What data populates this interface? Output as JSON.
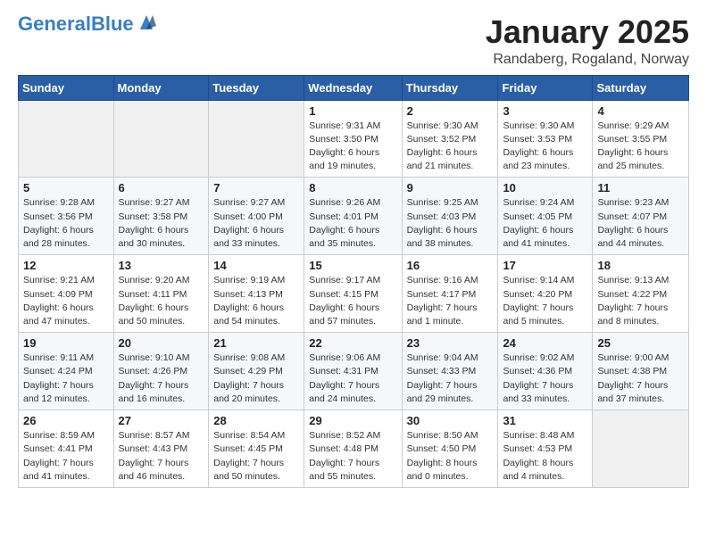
{
  "header": {
    "logo_main": "General",
    "logo_accent": "Blue",
    "main_title": "January 2025",
    "subtitle": "Randaberg, Rogaland, Norway"
  },
  "days_of_week": [
    "Sunday",
    "Monday",
    "Tuesday",
    "Wednesday",
    "Thursday",
    "Friday",
    "Saturday"
  ],
  "weeks": [
    [
      {
        "day": "",
        "info": ""
      },
      {
        "day": "",
        "info": ""
      },
      {
        "day": "",
        "info": ""
      },
      {
        "day": "1",
        "info": "Sunrise: 9:31 AM\nSunset: 3:50 PM\nDaylight: 6 hours\nand 19 minutes."
      },
      {
        "day": "2",
        "info": "Sunrise: 9:30 AM\nSunset: 3:52 PM\nDaylight: 6 hours\nand 21 minutes."
      },
      {
        "day": "3",
        "info": "Sunrise: 9:30 AM\nSunset: 3:53 PM\nDaylight: 6 hours\nand 23 minutes."
      },
      {
        "day": "4",
        "info": "Sunrise: 9:29 AM\nSunset: 3:55 PM\nDaylight: 6 hours\nand 25 minutes."
      }
    ],
    [
      {
        "day": "5",
        "info": "Sunrise: 9:28 AM\nSunset: 3:56 PM\nDaylight: 6 hours\nand 28 minutes."
      },
      {
        "day": "6",
        "info": "Sunrise: 9:27 AM\nSunset: 3:58 PM\nDaylight: 6 hours\nand 30 minutes."
      },
      {
        "day": "7",
        "info": "Sunrise: 9:27 AM\nSunset: 4:00 PM\nDaylight: 6 hours\nand 33 minutes."
      },
      {
        "day": "8",
        "info": "Sunrise: 9:26 AM\nSunset: 4:01 PM\nDaylight: 6 hours\nand 35 minutes."
      },
      {
        "day": "9",
        "info": "Sunrise: 9:25 AM\nSunset: 4:03 PM\nDaylight: 6 hours\nand 38 minutes."
      },
      {
        "day": "10",
        "info": "Sunrise: 9:24 AM\nSunset: 4:05 PM\nDaylight: 6 hours\nand 41 minutes."
      },
      {
        "day": "11",
        "info": "Sunrise: 9:23 AM\nSunset: 4:07 PM\nDaylight: 6 hours\nand 44 minutes."
      }
    ],
    [
      {
        "day": "12",
        "info": "Sunrise: 9:21 AM\nSunset: 4:09 PM\nDaylight: 6 hours\nand 47 minutes."
      },
      {
        "day": "13",
        "info": "Sunrise: 9:20 AM\nSunset: 4:11 PM\nDaylight: 6 hours\nand 50 minutes."
      },
      {
        "day": "14",
        "info": "Sunrise: 9:19 AM\nSunset: 4:13 PM\nDaylight: 6 hours\nand 54 minutes."
      },
      {
        "day": "15",
        "info": "Sunrise: 9:17 AM\nSunset: 4:15 PM\nDaylight: 6 hours\nand 57 minutes."
      },
      {
        "day": "16",
        "info": "Sunrise: 9:16 AM\nSunset: 4:17 PM\nDaylight: 7 hours\nand 1 minute."
      },
      {
        "day": "17",
        "info": "Sunrise: 9:14 AM\nSunset: 4:20 PM\nDaylight: 7 hours\nand 5 minutes."
      },
      {
        "day": "18",
        "info": "Sunrise: 9:13 AM\nSunset: 4:22 PM\nDaylight: 7 hours\nand 8 minutes."
      }
    ],
    [
      {
        "day": "19",
        "info": "Sunrise: 9:11 AM\nSunset: 4:24 PM\nDaylight: 7 hours\nand 12 minutes."
      },
      {
        "day": "20",
        "info": "Sunrise: 9:10 AM\nSunset: 4:26 PM\nDaylight: 7 hours\nand 16 minutes."
      },
      {
        "day": "21",
        "info": "Sunrise: 9:08 AM\nSunset: 4:29 PM\nDaylight: 7 hours\nand 20 minutes."
      },
      {
        "day": "22",
        "info": "Sunrise: 9:06 AM\nSunset: 4:31 PM\nDaylight: 7 hours\nand 24 minutes."
      },
      {
        "day": "23",
        "info": "Sunrise: 9:04 AM\nSunset: 4:33 PM\nDaylight: 7 hours\nand 29 minutes."
      },
      {
        "day": "24",
        "info": "Sunrise: 9:02 AM\nSunset: 4:36 PM\nDaylight: 7 hours\nand 33 minutes."
      },
      {
        "day": "25",
        "info": "Sunrise: 9:00 AM\nSunset: 4:38 PM\nDaylight: 7 hours\nand 37 minutes."
      }
    ],
    [
      {
        "day": "26",
        "info": "Sunrise: 8:59 AM\nSunset: 4:41 PM\nDaylight: 7 hours\nand 41 minutes."
      },
      {
        "day": "27",
        "info": "Sunrise: 8:57 AM\nSunset: 4:43 PM\nDaylight: 7 hours\nand 46 minutes."
      },
      {
        "day": "28",
        "info": "Sunrise: 8:54 AM\nSunset: 4:45 PM\nDaylight: 7 hours\nand 50 minutes."
      },
      {
        "day": "29",
        "info": "Sunrise: 8:52 AM\nSunset: 4:48 PM\nDaylight: 7 hours\nand 55 minutes."
      },
      {
        "day": "30",
        "info": "Sunrise: 8:50 AM\nSunset: 4:50 PM\nDaylight: 8 hours\nand 0 minutes."
      },
      {
        "day": "31",
        "info": "Sunrise: 8:48 AM\nSunset: 4:53 PM\nDaylight: 8 hours\nand 4 minutes."
      },
      {
        "day": "",
        "info": ""
      }
    ]
  ]
}
